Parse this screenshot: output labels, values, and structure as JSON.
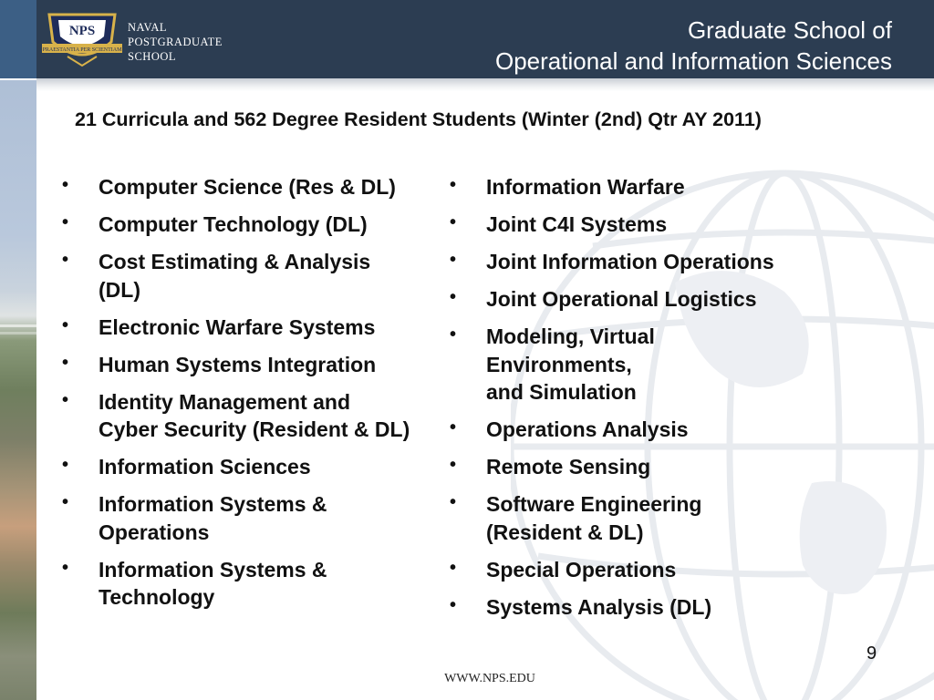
{
  "header": {
    "logo_text": "NPS",
    "logo_motto": "PRAESTANTIA PER SCIENTIAM",
    "school_name_lines": [
      "NAVAL",
      "POSTGRADUATE",
      "SCHOOL"
    ],
    "title_lines": [
      "Graduate School of",
      "Operational and Information Sciences"
    ]
  },
  "subtitle": "21 Curricula and 562  Degree Resident Students (Winter (2nd) Qtr AY 2011)",
  "bullet_symbol": "•",
  "left_column": [
    "Computer Science (Res & DL)",
    "Computer Technology (DL)",
    "Cost Estimating & Analysis\n(DL)",
    "Electronic Warfare Systems",
    "Human Systems Integration",
    "Identity Management and\nCyber Security (Resident & DL)",
    "Information Sciences",
    "Information Systems &\nOperations",
    "Information Systems &\nTechnology"
  ],
  "right_column": [
    "Information Warfare",
    "Joint C4I Systems",
    "Joint Information Operations",
    "Joint Operational Logistics",
    "Modeling, Virtual\nEnvironments,\nand Simulation",
    "Operations Analysis",
    "Remote Sensing",
    "Software Engineering\n(Resident & DL)",
    "Special Operations",
    "Systems Analysis (DL)"
  ],
  "page_number": "9",
  "footer_url": "WWW.NPS.EDU",
  "colors": {
    "header_bg": "#2c3d52",
    "header_accent": "#3c5f85",
    "text": "#111111",
    "logo_gold": "#d8b24a"
  }
}
